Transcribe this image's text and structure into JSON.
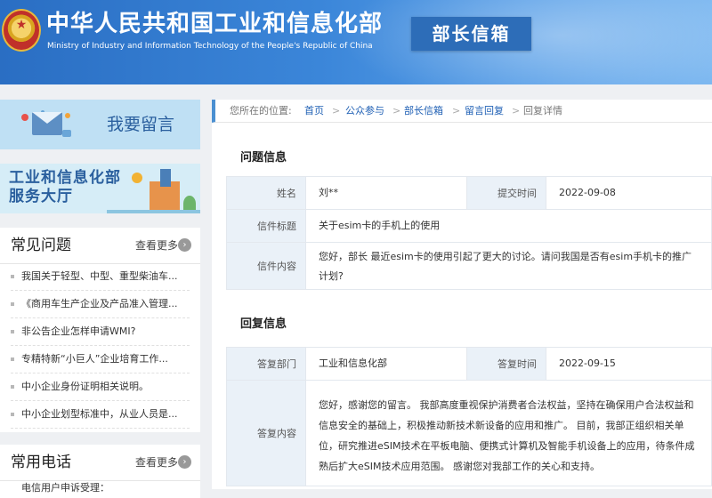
{
  "header": {
    "title_cn": "中华人民共和国工业和信息化部",
    "title_en": "Ministry of Industry and Information Technology of the People's Republic of China",
    "badge": "部长信箱"
  },
  "sidebar": {
    "banner_leave_message": "我要留言",
    "banner_service_hall_line1": "工业和信息化部",
    "banner_service_hall_line2": "服务大厅",
    "faq": {
      "title": "常见问题",
      "more": "查看更多",
      "items": [
        "我国关于轻型、中型、重型柴油车...",
        "《商用车生产企业及产品准入管理...",
        "非公告企业怎样申请WMI?",
        "专精特新“小巨人”企业培育工作...",
        "中小企业身份证明相关说明。",
        "中小企业划型标准中，从业人员是..."
      ]
    },
    "phone": {
      "title": "常用电话",
      "more": "查看更多",
      "first_item": "电信用户申诉受理："
    }
  },
  "breadcrumb": {
    "prefix": "您所在的位置:",
    "items": [
      "首页",
      "公众参与",
      "部长信箱",
      "留言回复"
    ],
    "current": "回复详情",
    "separator": ">"
  },
  "question": {
    "section_title": "问题信息",
    "name_label": "姓名",
    "name_value": "刘**",
    "date_label": "提交时间",
    "date_value": "2022-09-08",
    "subject_label": "信件标题",
    "subject_value": "关于esim卡的手机上的使用",
    "content_label": "信件内容",
    "content_value": "您好，部长 最近esim卡的使用引起了更大的讨论。请问我国是否有esim手机卡的推广计划?"
  },
  "reply": {
    "section_title": "回复信息",
    "dept_label": "答复部门",
    "dept_value": "工业和信息化部",
    "date_label": "答复时间",
    "date_value": "2022-09-15",
    "content_label": "答复内容",
    "content_value": "您好，感谢您的留言。 我部高度重视保护消费者合法权益，坚持在确保用户合法权益和信息安全的基础上，积极推动新技术新设备的应用和推广。 目前，我部正组织相关单位，研究推进eSIM技术在平板电脑、便携式计算机及智能手机设备上的应用，待条件成熟后扩大eSIM技术应用范围。 感谢您对我部工作的关心和支持。"
  },
  "colors": {
    "header_blue": "#2a6ec3",
    "label_bg": "#eaf1f8",
    "link_blue": "#1e5fb4"
  }
}
